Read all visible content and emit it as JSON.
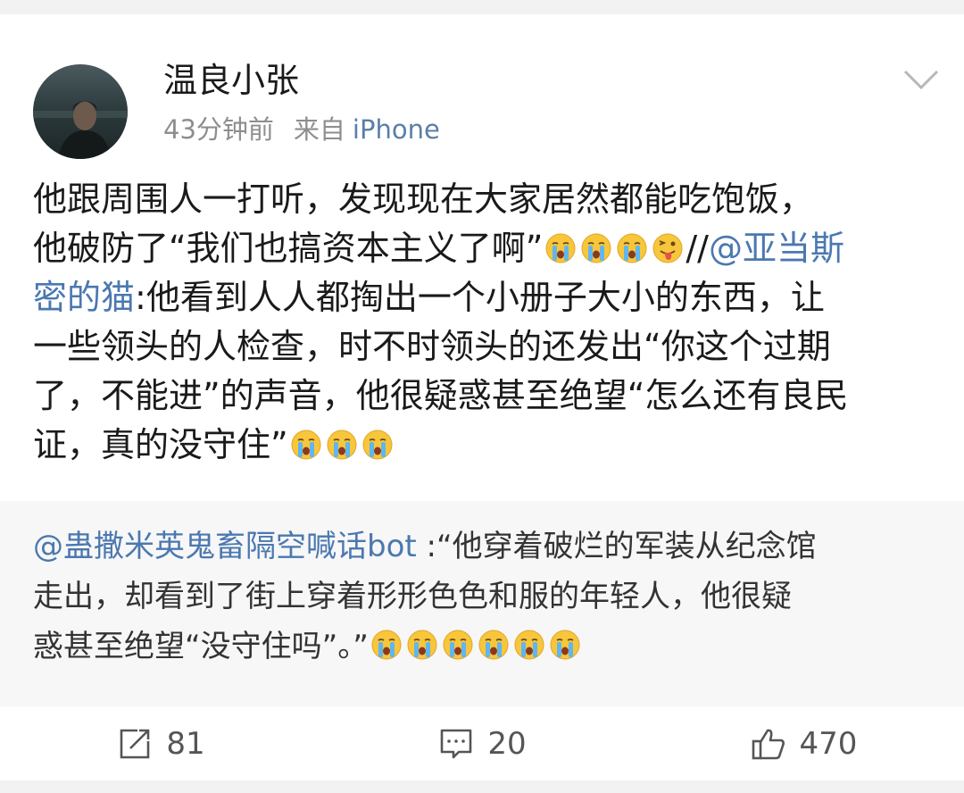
{
  "post": {
    "user_name": "温良小张",
    "time": "43分钟前",
    "via": "来自",
    "device": "iPhone",
    "body": {
      "line1": "他跟周围人一打听，发现现在大家居然都能吃饱饭，",
      "line2_text": "他破防了“我们也搞资本主义了啊”",
      "line2_sep": "//",
      "line2_mention": "@亚当斯",
      "line3_mention": "密的猫",
      "line3_text": ":他看到人人都掏出一个小册子大小的东西，让",
      "line4": "一些领头的人检查，时不时领头的还发出“你这个过期",
      "line5": "了，不能进”的声音，他很疑惑甚至绝望“怎么还有良民",
      "line6": "证，真的没守住”"
    },
    "emoji": {
      "crying": "crying-face-icon",
      "tongue": "winking-tongue-face-icon"
    }
  },
  "repost": {
    "mention": "@蛊撒米英鬼畜隔空喊话bot",
    "line1_text": " :“他穿着破烂的军装从纪念馆",
    "line2": "走出，却看到了街上穿着形形色色和服的年轻人，他很疑",
    "line3": "惑甚至绝望“没守住吗”。”"
  },
  "actions": {
    "repost_count": "81",
    "comment_count": "20",
    "like_count": "470"
  },
  "icons": {
    "repost": "share-icon",
    "comment": "comment-icon",
    "like": "thumbs-up-icon",
    "more": "chevron-down-icon"
  },
  "colors": {
    "link": "#4b78b0",
    "meta": "#8e8e8e",
    "repost_bg": "#f7f7f7",
    "page_bg": "#f2f2f2"
  }
}
